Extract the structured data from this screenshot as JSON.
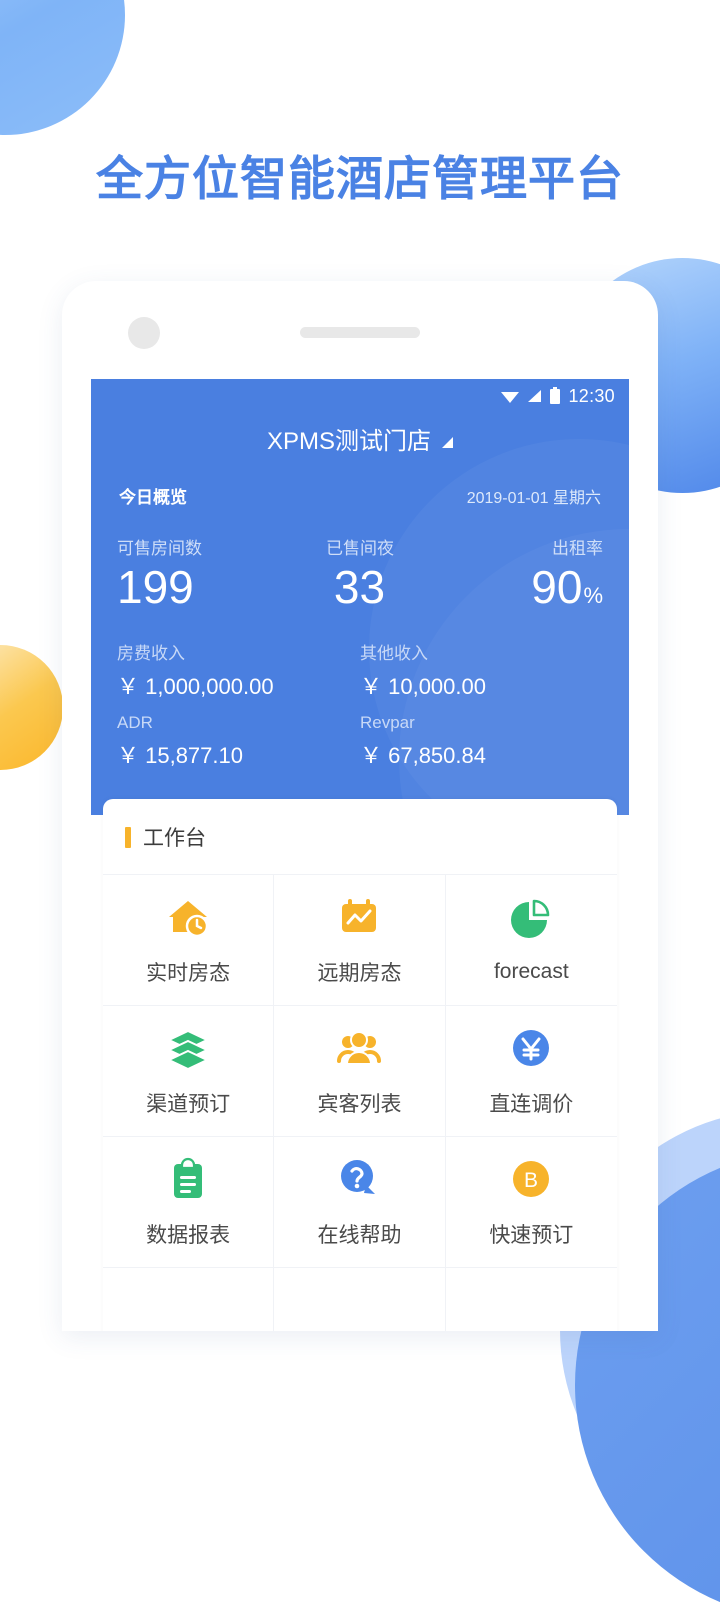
{
  "headline": "全方位智能酒店管理平台",
  "colors": {
    "brand_blue": "#4a7fe0",
    "headline_blue": "#4a82e4",
    "accent_orange": "#f7b32b",
    "icon_green": "#34bd78",
    "icon_blue": "#4a86e8"
  },
  "phone": {
    "statusbar": {
      "wifi_icon": "wifi-icon",
      "signal_icon": "signal-icon",
      "battery_icon": "battery-icon",
      "time": "12:30"
    },
    "app_title": "XPMS测试门店",
    "title_caret_icon": "caret-down-icon",
    "overview": {
      "label": "今日概览",
      "date": "2019-01-01 星期六"
    },
    "kpis": [
      {
        "label": "可售房间数",
        "value": "199",
        "unit": ""
      },
      {
        "label": "已售间夜",
        "value": "33",
        "unit": ""
      },
      {
        "label": "出租率",
        "value": "90",
        "unit": "%"
      }
    ],
    "money": [
      {
        "label": "房费收入",
        "value": "￥ 1,000,000.00"
      },
      {
        "label": "其他收入",
        "value": "￥ 10,000.00"
      },
      {
        "label": "ADR",
        "value": "￥ 15,877.10"
      },
      {
        "label": "Revpar",
        "value": "￥ 67,850.84"
      }
    ],
    "workbench": {
      "title": "工作台",
      "items": [
        {
          "label": "实时房态",
          "icon": "house-clock-icon",
          "color": "#f7b32b"
        },
        {
          "label": "远期房态",
          "icon": "calendar-chart-icon",
          "color": "#f7b32b"
        },
        {
          "label": "forecast",
          "icon": "pie-chart-icon",
          "color": "#34bd78"
        },
        {
          "label": "渠道预订",
          "icon": "layers-icon",
          "color": "#34bd78"
        },
        {
          "label": "宾客列表",
          "icon": "people-icon",
          "color": "#f7b32b"
        },
        {
          "label": "直连调价",
          "icon": "yuan-circle-icon",
          "color": "#4a86e8"
        },
        {
          "label": "数据报表",
          "icon": "clipboard-icon",
          "color": "#34bd78"
        },
        {
          "label": "在线帮助",
          "icon": "help-bubble-icon",
          "color": "#4a86e8"
        },
        {
          "label": "快速预订",
          "icon": "b-circle-icon",
          "color": "#f7b32b"
        }
      ]
    }
  }
}
